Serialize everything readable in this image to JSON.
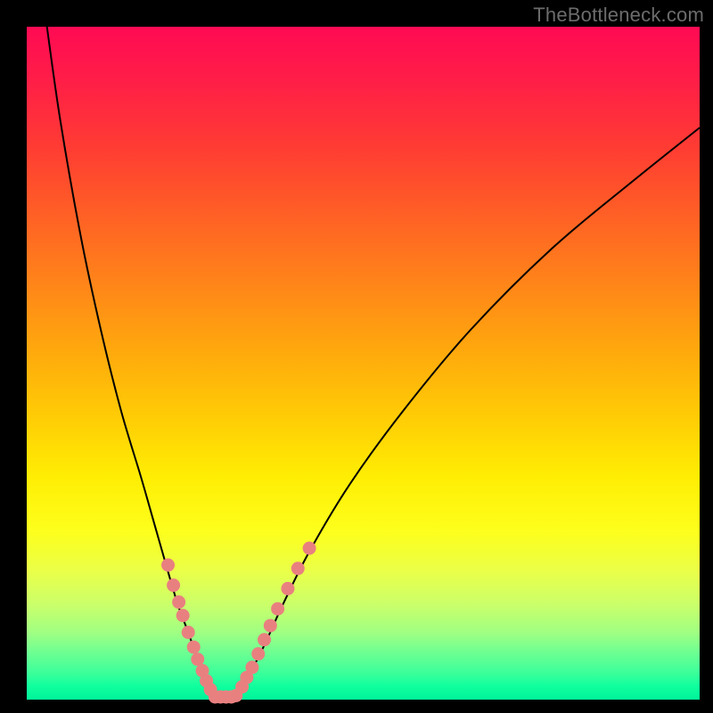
{
  "watermark": "TheBottleneck.com",
  "colors": {
    "curve": "#000000",
    "marker_fill": "#e98080",
    "marker_stroke": "#cf6a6a",
    "gradient_top": "#ff0a53",
    "gradient_bottom": "#00f49a",
    "background": "#000000"
  },
  "chart_data": {
    "type": "line",
    "title": "",
    "xlabel": "",
    "ylabel": "",
    "xlim": [
      0,
      100
    ],
    "ylim": [
      0,
      100
    ],
    "grid": false,
    "series": [
      {
        "name": "left-branch",
        "x": [
          3,
          5,
          8,
          11,
          14,
          17,
          19,
          21,
          22.5,
          24,
          25.2,
          26.3,
          27.3,
          28
        ],
        "y": [
          100,
          86,
          69,
          55,
          43,
          33,
          26,
          19,
          14,
          10,
          6.5,
          3.5,
          1.5,
          0
        ]
      },
      {
        "name": "right-branch",
        "x": [
          31,
          32,
          33.5,
          35.5,
          38,
          42,
          48,
          56,
          66,
          78,
          90,
          100
        ],
        "y": [
          0,
          1.8,
          4.5,
          8.5,
          14,
          22,
          32,
          43,
          55,
          67,
          77,
          85
        ]
      },
      {
        "name": "bottom-bridge",
        "x": [
          28,
          29,
          30,
          31
        ],
        "y": [
          0,
          0,
          0,
          0
        ]
      }
    ],
    "markers": {
      "left_cluster": [
        {
          "x": 21.0,
          "y": 20.0
        },
        {
          "x": 21.8,
          "y": 17.0
        },
        {
          "x": 22.6,
          "y": 14.5
        },
        {
          "x": 23.2,
          "y": 12.5
        },
        {
          "x": 24.0,
          "y": 10.0
        },
        {
          "x": 24.8,
          "y": 7.8
        },
        {
          "x": 25.4,
          "y": 6.0
        },
        {
          "x": 26.1,
          "y": 4.3
        },
        {
          "x": 26.7,
          "y": 2.8
        },
        {
          "x": 27.3,
          "y": 1.5
        }
      ],
      "bottom_cluster": [
        {
          "x": 28.0,
          "y": 0.4
        },
        {
          "x": 28.8,
          "y": 0.4
        },
        {
          "x": 29.6,
          "y": 0.4
        },
        {
          "x": 30.4,
          "y": 0.4
        },
        {
          "x": 31.1,
          "y": 0.6
        }
      ],
      "right_cluster": [
        {
          "x": 32.0,
          "y": 1.9
        },
        {
          "x": 32.7,
          "y": 3.3
        },
        {
          "x": 33.5,
          "y": 4.8
        },
        {
          "x": 34.4,
          "y": 6.8
        },
        {
          "x": 35.3,
          "y": 8.9
        },
        {
          "x": 36.2,
          "y": 11.0
        },
        {
          "x": 37.3,
          "y": 13.5
        },
        {
          "x": 38.8,
          "y": 16.5
        },
        {
          "x": 40.3,
          "y": 19.5
        },
        {
          "x": 42.0,
          "y": 22.5
        }
      ]
    }
  }
}
